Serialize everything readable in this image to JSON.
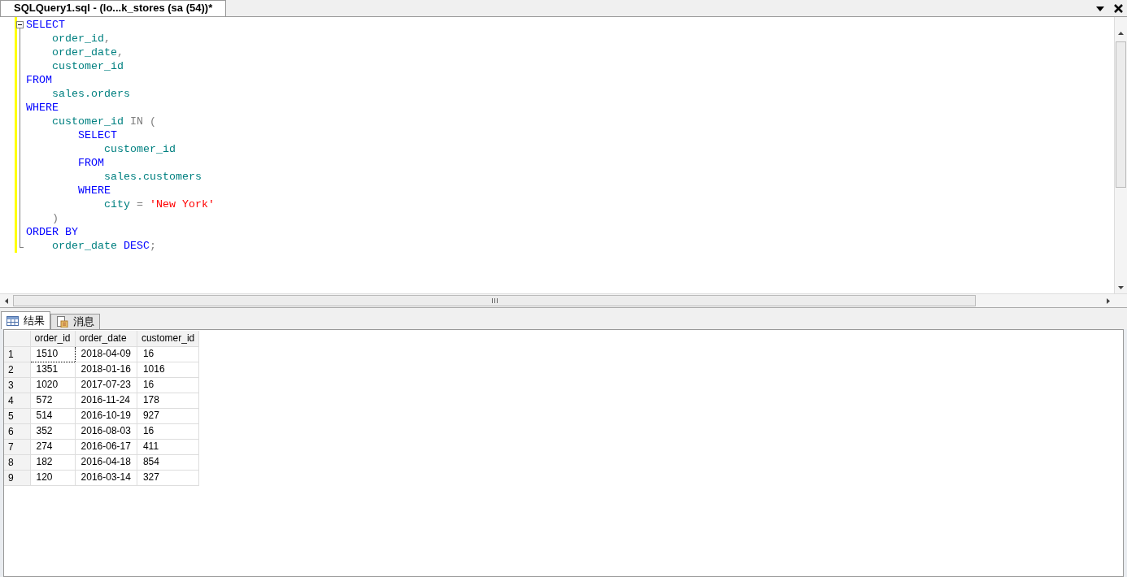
{
  "document_tab": {
    "title": "SQLQuery1.sql - (lo...k_stores (sa (54))*"
  },
  "editor": {
    "lines": [
      {
        "tokens": [
          {
            "kind": "keyword",
            "text": "SELECT"
          }
        ],
        "children": [
          {
            "tokens": [
              {
                "kind": "identifier",
                "text": "order_id"
              },
              {
                "kind": "operator",
                "text": ","
              }
            ]
          },
          {
            "tokens": [
              {
                "kind": "identifier",
                "text": "order_date"
              },
              {
                "kind": "operator",
                "text": ","
              }
            ]
          },
          {
            "tokens": [
              {
                "kind": "identifier",
                "text": "customer_id"
              }
            ]
          }
        ]
      },
      {
        "tokens": [
          {
            "kind": "keyword",
            "text": "FROM"
          }
        ],
        "children": [
          {
            "tokens": [
              {
                "kind": "identifier",
                "text": "sales.orders"
              }
            ]
          }
        ]
      },
      {
        "tokens": [
          {
            "kind": "keyword",
            "text": "WHERE"
          }
        ],
        "children": [
          {
            "tokens": [
              {
                "kind": "identifier",
                "text": "customer_id"
              },
              {
                "kind": "operator",
                "text": "IN (",
                "gap_before": true
              }
            ],
            "children": [
              {
                "tokens": [
                  {
                    "kind": "keyword",
                    "text": "SELECT"
                  }
                ],
                "children": [
                  {
                    "tokens": [
                      {
                        "kind": "identifier",
                        "text": "customer_id"
                      }
                    ]
                  }
                ]
              },
              {
                "tokens": [
                  {
                    "kind": "keyword",
                    "text": "FROM"
                  }
                ],
                "children": [
                  {
                    "tokens": [
                      {
                        "kind": "identifier",
                        "text": "sales.customers"
                      }
                    ]
                  }
                ]
              },
              {
                "tokens": [
                  {
                    "kind": "keyword",
                    "text": "WHERE"
                  }
                ],
                "children": [
                  {
                    "tokens": [
                      {
                        "kind": "identifier",
                        "text": "city"
                      },
                      {
                        "kind": "operator",
                        "text": "=",
                        "gap_before": true
                      },
                      {
                        "kind": "string",
                        "text": "'New York'",
                        "gap_before": true
                      }
                    ]
                  }
                ]
              }
            ]
          },
          {
            "tokens": [
              {
                "kind": "operator",
                "text": ")"
              }
            ]
          }
        ]
      },
      {
        "tokens": [
          {
            "kind": "keyword",
            "text": "ORDER BY"
          }
        ],
        "children": [
          {
            "tokens": [
              {
                "kind": "identifier",
                "text": "order_date"
              },
              {
                "kind": "keyword",
                "text": "DESC",
                "gap_before": true
              },
              {
                "kind": "operator",
                "text": ";"
              }
            ]
          }
        ]
      }
    ]
  },
  "result_tabs": [
    {
      "label": "结果",
      "kind": "grid",
      "selected": true
    },
    {
      "label": "消息",
      "kind": "messages",
      "selected": false
    }
  ],
  "results": {
    "columns": [
      "order_id",
      "order_date",
      "customer_id"
    ],
    "rows": [
      {
        "number": "1",
        "cells": [
          "1510",
          "2018-04-09",
          "16"
        ],
        "focused": true
      },
      {
        "number": "2",
        "cells": [
          "1351",
          "2018-01-16",
          "1016"
        ],
        "focused": false
      },
      {
        "number": "3",
        "cells": [
          "1020",
          "2017-07-23",
          "16"
        ],
        "focused": false
      },
      {
        "number": "4",
        "cells": [
          "572",
          "2016-11-24",
          "178"
        ],
        "focused": false
      },
      {
        "number": "5",
        "cells": [
          "514",
          "2016-10-19",
          "927"
        ],
        "focused": false
      },
      {
        "number": "6",
        "cells": [
          "352",
          "2016-08-03",
          "16"
        ],
        "focused": false
      },
      {
        "number": "7",
        "cells": [
          "274",
          "2016-06-17",
          "411"
        ],
        "focused": false
      },
      {
        "number": "8",
        "cells": [
          "182",
          "2016-04-18",
          "854"
        ],
        "focused": false
      },
      {
        "number": "9",
        "cells": [
          "120",
          "2016-03-14",
          "327"
        ],
        "focused": false
      }
    ]
  }
}
